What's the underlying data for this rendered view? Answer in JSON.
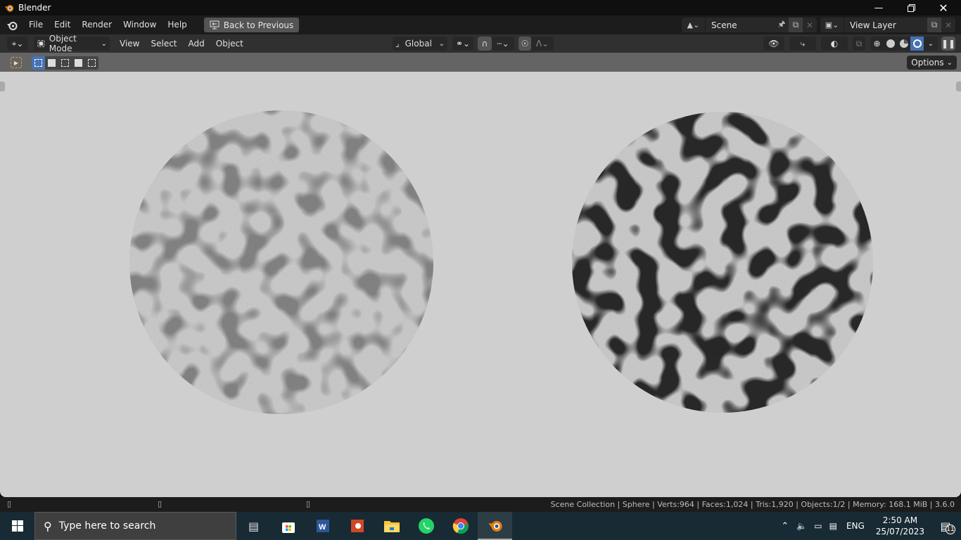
{
  "window": {
    "title": "Blender",
    "controls": [
      "minimize",
      "restore",
      "close"
    ]
  },
  "menubar": {
    "items": [
      "File",
      "Edit",
      "Render",
      "Window",
      "Help"
    ],
    "back_button": "Back to Previous",
    "scene": {
      "name": "Scene"
    },
    "view_layer": {
      "name": "View Layer"
    }
  },
  "header": {
    "mode": "Object Mode",
    "menus": [
      "View",
      "Select",
      "Add",
      "Object"
    ],
    "transform_orientation": "Global",
    "shading_active": "rendered",
    "accent": "#4772b3"
  },
  "tool_header": {
    "options_label": "Options"
  },
  "viewport": {
    "objects": [
      {
        "name": "sphere-left",
        "crack_intensity": "light"
      },
      {
        "name": "sphere-right",
        "crack_intensity": "strong"
      }
    ]
  },
  "status_bar": {
    "text": "Scene Collection | Sphere | Verts:964 | Faces:1,024 | Tris:1,920 | Objects:1/2 | Memory: 168.1 MiB | 3.6.0"
  },
  "taskbar": {
    "search_placeholder": "Type here to search",
    "apps": [
      "task-view",
      "microsoft-store",
      "word",
      "powerpoint",
      "file-explorer",
      "whatsapp",
      "chrome",
      "blender"
    ],
    "language": "ENG",
    "time": "2:50 AM",
    "date": "25/07/2023",
    "notification_count": "11"
  }
}
